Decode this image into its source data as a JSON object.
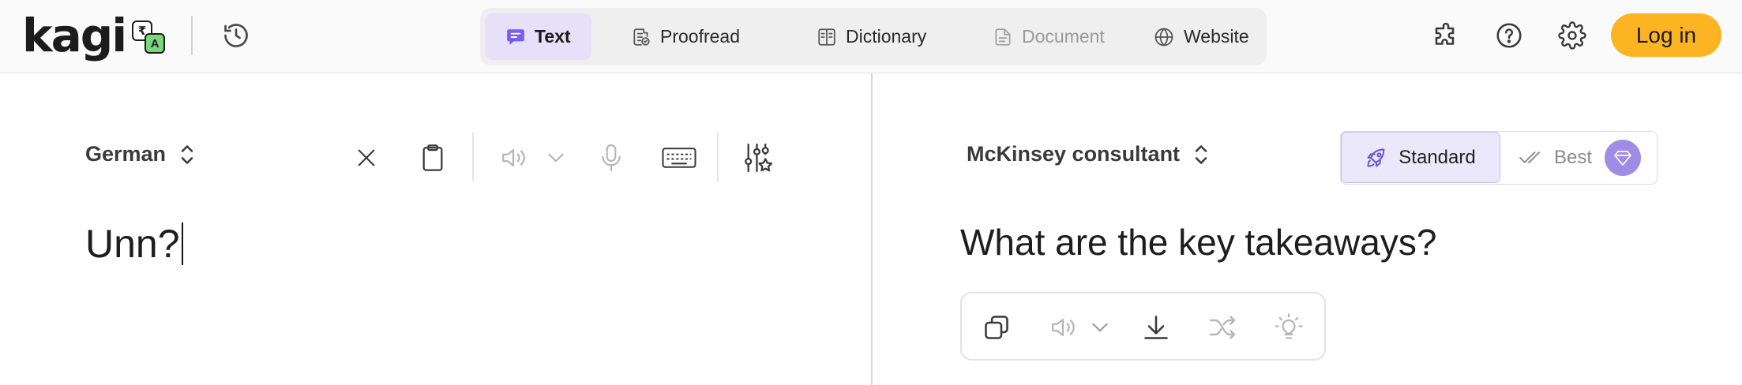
{
  "header": {
    "logo": {
      "wordmark": "kagi",
      "badge_glyph_a": "₹",
      "badge_glyph_b": "A"
    },
    "modes": [
      {
        "label": "Text",
        "icon": "chat-bubble-icon",
        "state": "active"
      },
      {
        "label": "Proofread",
        "icon": "proofread-icon",
        "state": "normal"
      },
      {
        "label": "Dictionary",
        "icon": "book-icon",
        "state": "normal"
      },
      {
        "label": "Document",
        "icon": "document-icon",
        "state": "disabled"
      },
      {
        "label": "Website",
        "icon": "globe-icon",
        "state": "normal"
      }
    ],
    "right_icons": [
      "extension-puzzle-icon",
      "help-icon",
      "settings-gear-icon"
    ],
    "login_label": "Log in"
  },
  "source": {
    "language": "German",
    "text": "Unn?",
    "tools": [
      "clear-icon",
      "paste-clipboard-icon",
      "speaker-icon",
      "chevron-down-icon",
      "microphone-icon",
      "keyboard-icon",
      "sliders-settings-icon"
    ]
  },
  "target": {
    "language": "McKinsey consultant",
    "text": "What are the key takeaways?",
    "quality": {
      "standard_label": "Standard",
      "best_label": "Best",
      "selected": "Standard"
    },
    "tools": [
      "copy-icon",
      "speaker-icon",
      "chevron-down-icon",
      "download-icon",
      "shuffle-icon",
      "lightbulb-icon"
    ]
  },
  "colors": {
    "accent_purple": "#e6e1f9",
    "login_yellow": "#fdb422",
    "gem_purple": "#9f8ce6",
    "header_bg": "#fafafa"
  }
}
